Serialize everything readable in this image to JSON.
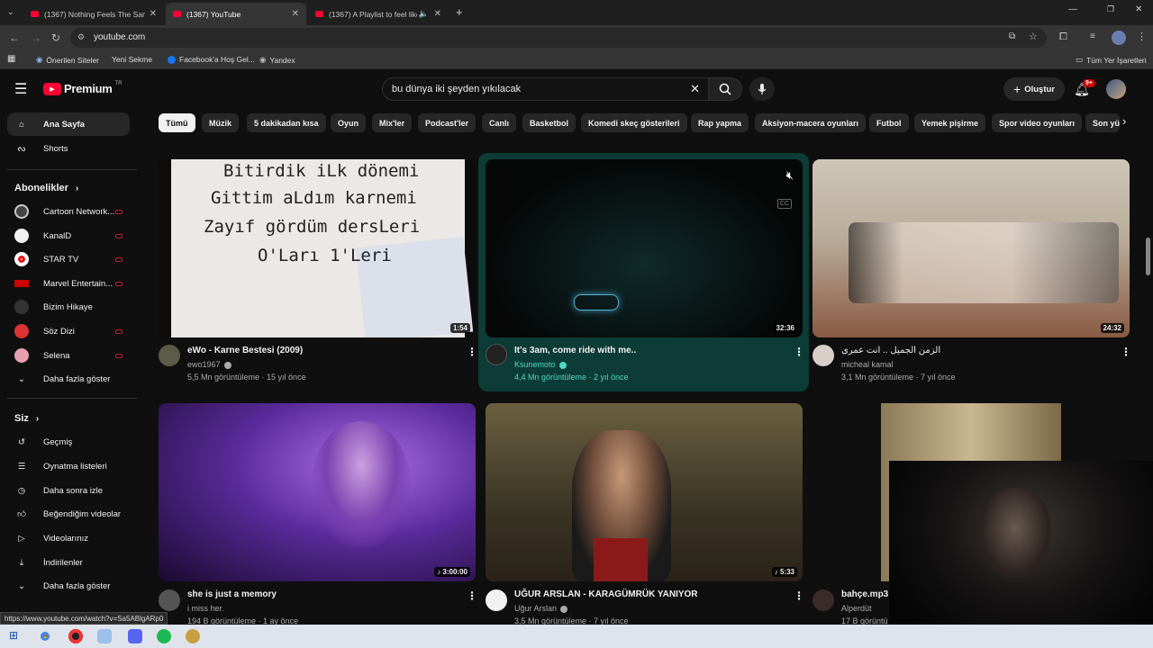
{
  "browser": {
    "tabs": [
      {
        "title": "(1367) Nothing Feels The Sam",
        "active": false
      },
      {
        "title": "(1367) YouTube",
        "active": true
      },
      {
        "title": "(1367) A Playlist to feel like",
        "active": false
      }
    ],
    "url": "youtube.com",
    "bookmarks": [
      "Önerilen Siteler",
      "Yeni Sekme",
      "Facebook'a Hoş Gel...",
      "Yandex"
    ],
    "all_bookmarks": "Tüm Yer İşaretleri",
    "status_url": "https://www.youtube.com/watch?v=Sa5ABlgARp0"
  },
  "header": {
    "logo": "Premium",
    "region": "TR",
    "search_value": "bu dünya iki şeyden yıkılacak",
    "create_label": "Oluştur",
    "notif_count": "9+"
  },
  "chips": [
    "Tümü",
    "Müzik",
    "5 dakikadan kısa",
    "Oyun",
    "Mix'ler",
    "Podcast'ler",
    "Canlı",
    "Basketbol",
    "Komedi skeç gösterileri",
    "Rap yapma",
    "Aksiyon-macera oyunları",
    "Futbol",
    "Yemek pişirme",
    "Spor video oyunları",
    "Son yü"
  ],
  "sidebar": {
    "home": "Ana Sayfa",
    "shorts": "Shorts",
    "subs_title": "Abonelikler",
    "subs": [
      {
        "label": "Cartoon Network...",
        "color": "#444"
      },
      {
        "label": "KanalD",
        "color": "#f1f1f1"
      },
      {
        "label": "STAR TV",
        "color": "#e11"
      },
      {
        "label": "Marvel Entertain...",
        "color": "#c00"
      },
      {
        "label": "Bizim Hikaye",
        "color": "#333"
      },
      {
        "label": "Söz Dizi",
        "color": "#d33"
      },
      {
        "label": "Selena",
        "color": "#e8a0b0"
      }
    ],
    "show_more": "Daha fazla göster",
    "you_title": "Siz",
    "you_items": [
      "Geçmiş",
      "Oynatma listeleri",
      "Daha sonra izle",
      "Beğendiğim videolar",
      "Videolarınız",
      "İndirilenler",
      "Daha fazla göster"
    ]
  },
  "videos": [
    {
      "title": "eWo - Karne Bestesi (2009)",
      "channel": "ewo1967",
      "verified": true,
      "meta": "5,5 Mn görüntüleme · 15 yıl önce",
      "duration": "1:54",
      "thumb_lines": [
        "Bitirdik iLk dönemi",
        "Gittim aLdım karnemi",
        "Zayıf gördüm dersLeri",
        "O'Ları 1'Leri"
      ]
    },
    {
      "title": "It's 3am, come ride with me..",
      "channel": "Ksunemoto",
      "verified": true,
      "meta": "4,4 Mn görüntüleme · 2 yıl önce",
      "duration": "32:36"
    },
    {
      "title": "الزمن الجميل .. انت عمرى",
      "channel": "micheal kamal",
      "verified": false,
      "meta": "3,1 Mn görüntüleme · 7 yıl önce",
      "duration": "24:32"
    },
    {
      "title": "she is just a memory",
      "channel": "i miss her.",
      "verified": false,
      "meta": "194 B görüntüleme · 1 ay önce",
      "duration": "3:00:00"
    },
    {
      "title": "UĞUR ARSLAN - KARAGÜMRÜK YANIYOR",
      "channel": "Uğur Arslan",
      "verified": true,
      "meta": "3,5 Mn görüntüleme · 7 yıl önce",
      "duration": "5:33"
    },
    {
      "title": "bahçe.mp3",
      "channel": "Alperdüt",
      "verified": false,
      "meta": "17 B görüntü",
      "duration": ""
    }
  ],
  "colors": {
    "bg": "#0f0f0f",
    "brand": "#ff0033",
    "hover_card": "#0d3b36"
  }
}
